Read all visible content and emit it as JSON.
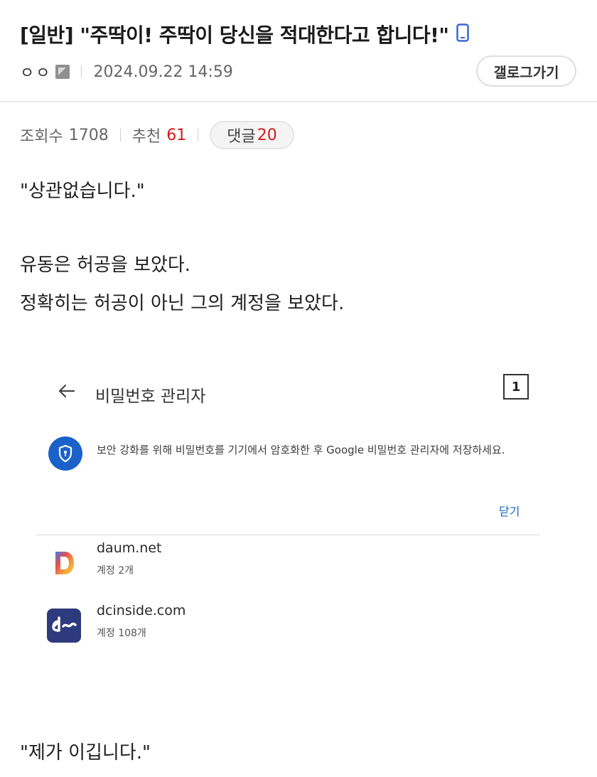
{
  "post": {
    "title": "[일반] \"주딱이! 주딱이 당신을 적대한다고 합니다!\"",
    "author": "ㅇㅇ",
    "datetime": "2024.09.22 14:59",
    "gallog_button": "갤로그가기"
  },
  "stats": {
    "views_label": "조회수",
    "views": "1708",
    "recommend_label": "추천",
    "recommend": "61",
    "comments_label": "댓글",
    "comments": "20"
  },
  "body": {
    "line1": "\"상관없습니다.\"",
    "line2": "유동은 허공을 보았다.",
    "line3": "정확히는 허공이 아닌 그의 계정을 보았다.",
    "line4": "\"제가 이깁니다.\""
  },
  "embedded_screenshot": {
    "title": "비밀번호 관리자",
    "count": "1",
    "notice": "보안 강화를 위해 비밀번호를 기기에서 암호화한 후 Google 비밀번호 관리자에 저장하세요.",
    "close_label": "닫기",
    "sites": [
      {
        "name": "daum.net",
        "accounts": "계정 2개",
        "icon": "daum-logo-icon"
      },
      {
        "name": "dcinside.com",
        "accounts": "계정 108개",
        "icon": "dcinside-logo-icon"
      }
    ]
  },
  "colors": {
    "accent_red": "#d31a1a",
    "google_blue": "#1a62c9",
    "dc_navy": "#2e3a7e"
  }
}
